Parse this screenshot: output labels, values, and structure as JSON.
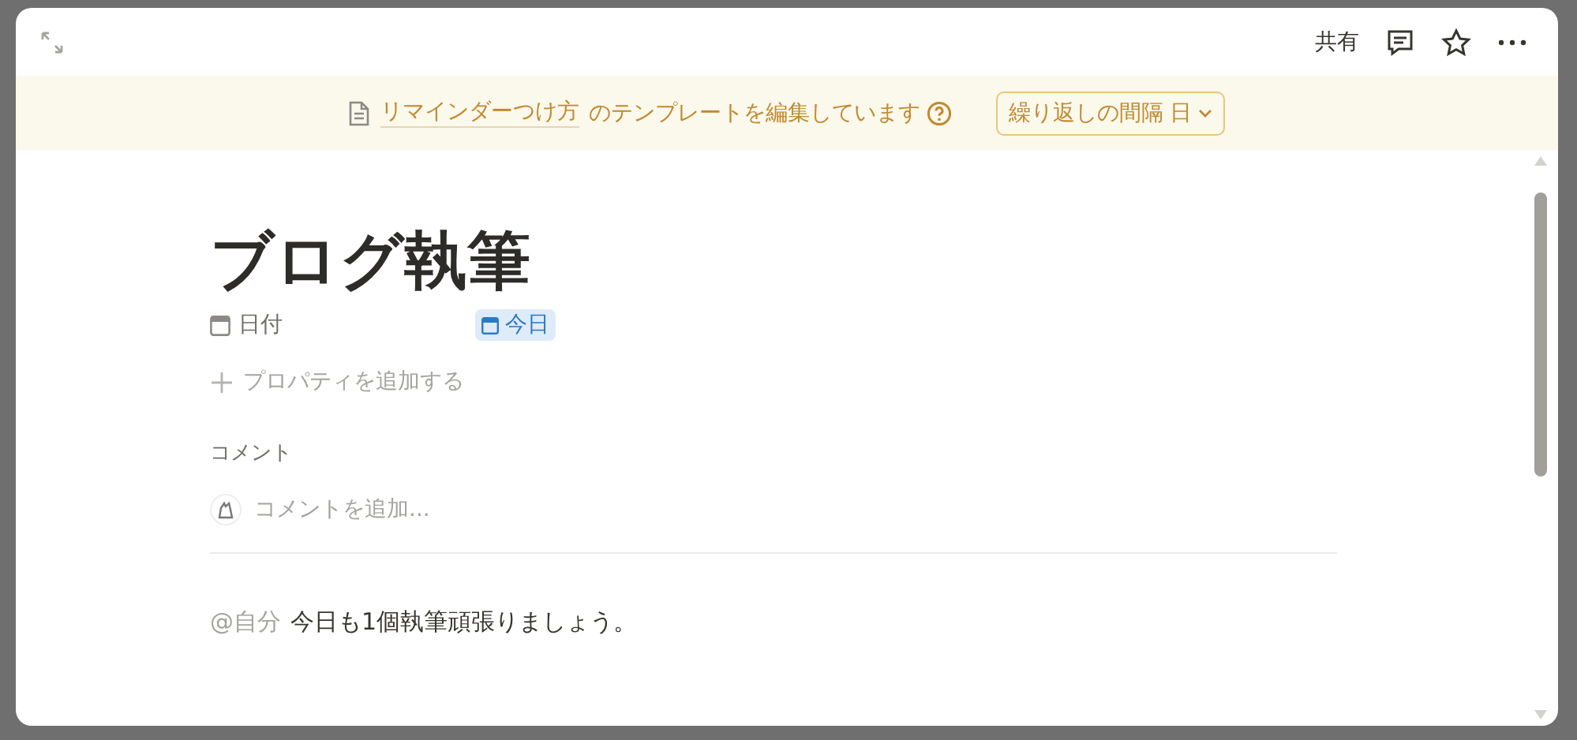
{
  "top_bar": {
    "share": "共有"
  },
  "banner": {
    "template_link": "リマインダーつけ方",
    "message": "のテンプレートを編集しています",
    "repeat_button": "繰り返しの間隔 日"
  },
  "page": {
    "title": "ブログ執筆",
    "properties": [
      {
        "name": "日付",
        "value": "今日"
      }
    ],
    "add_property": "プロパティを追加する",
    "comments_heading": "コメント",
    "comment_placeholder": "コメントを追加...",
    "body": {
      "mention": "@自分",
      "text": "今日も1個執筆頑張りましょう。"
    }
  }
}
